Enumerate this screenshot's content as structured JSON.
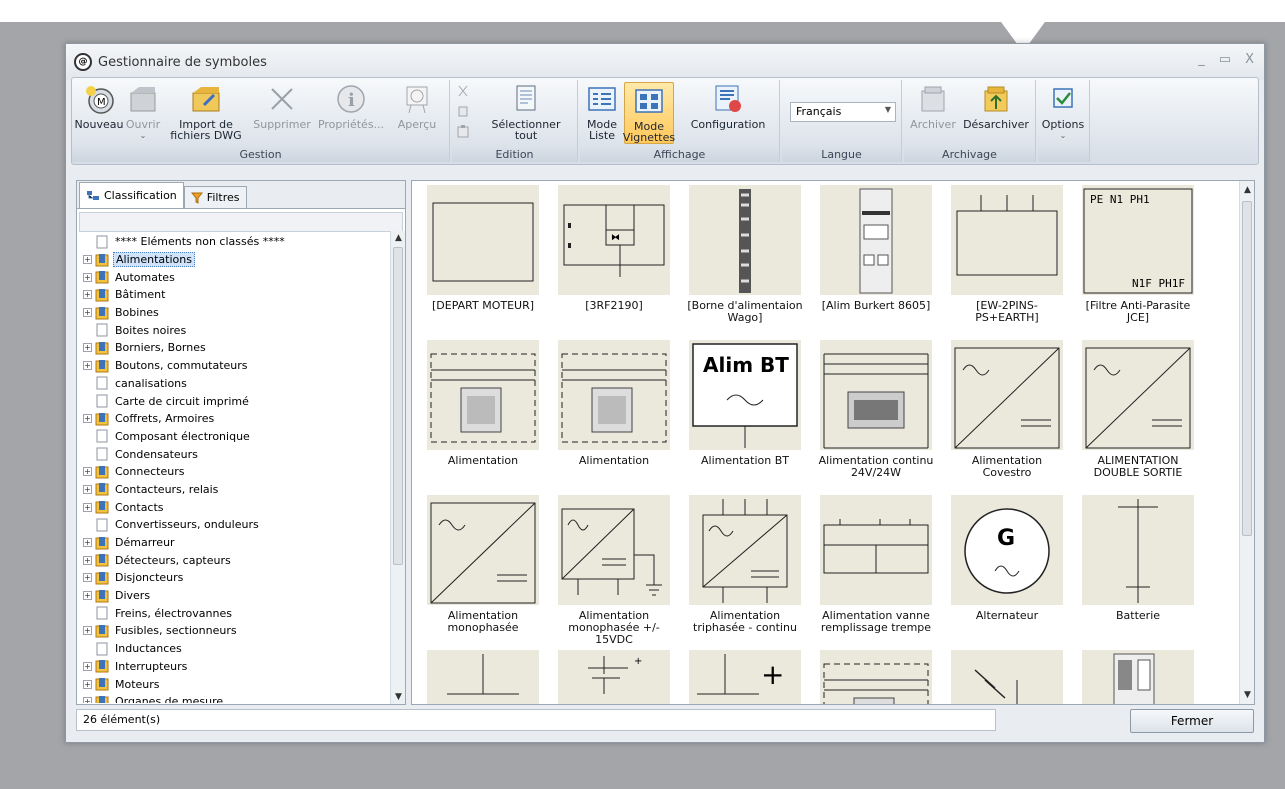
{
  "window": {
    "title": "Gestionnaire de symboles",
    "controls": [
      "_",
      "▭",
      "X"
    ]
  },
  "ribbon": {
    "groups": [
      {
        "label": "Gestion",
        "buttons": [
          {
            "label": "Nouveau",
            "icon": "new-symbol-icon"
          },
          {
            "label": "Ouvrir",
            "icon": "open-icon"
          },
          {
            "label": "Import de fichiers DWG",
            "icon": "import-dwg-icon"
          },
          {
            "label": "Supprimer",
            "icon": "delete-icon"
          },
          {
            "label": "Propriétés...",
            "icon": "info-icon"
          },
          {
            "label": "Aperçu",
            "icon": "preview-icon"
          }
        ]
      },
      {
        "label": "Edition",
        "buttons": [
          {
            "label": "Sélectionner tout",
            "icon": "select-all-icon"
          }
        ]
      },
      {
        "label": "Affichage",
        "buttons": [
          {
            "label": "Mode Liste",
            "icon": "list-mode-icon"
          },
          {
            "label": "Mode Vignettes",
            "icon": "thumbnail-mode-icon"
          },
          {
            "label": "Configuration",
            "icon": "configuration-icon"
          }
        ]
      },
      {
        "label": "Langue",
        "select_value": "Français"
      },
      {
        "label": "Archivage",
        "buttons": [
          {
            "label": "Archiver",
            "icon": "archive-icon"
          },
          {
            "label": "Désarchiver",
            "icon": "unarchive-icon"
          }
        ]
      },
      {
        "label": "",
        "buttons": [
          {
            "label": "Options",
            "icon": "checkbox-icon"
          }
        ]
      }
    ]
  },
  "left": {
    "tabs": [
      "Classification",
      "Filtres"
    ],
    "tree": [
      {
        "label": "**** Eléments non classés ****",
        "expandable": false
      },
      {
        "label": "Alimentations",
        "expandable": true,
        "selected": true
      },
      {
        "label": "Automates",
        "expandable": true
      },
      {
        "label": "Bâtiment",
        "expandable": true
      },
      {
        "label": "Bobines",
        "expandable": true
      },
      {
        "label": "Boites noires",
        "expandable": false
      },
      {
        "label": "Borniers, Bornes",
        "expandable": true
      },
      {
        "label": "Boutons, commutateurs",
        "expandable": true
      },
      {
        "label": "canalisations",
        "expandable": false
      },
      {
        "label": "Carte de circuit imprimé",
        "expandable": false
      },
      {
        "label": "Coffrets, Armoires",
        "expandable": true
      },
      {
        "label": "Composant électronique",
        "expandable": false
      },
      {
        "label": "Condensateurs",
        "expandable": false
      },
      {
        "label": "Connecteurs",
        "expandable": true
      },
      {
        "label": "Contacteurs, relais",
        "expandable": true
      },
      {
        "label": "Contacts",
        "expandable": true
      },
      {
        "label": "Convertisseurs, onduleurs",
        "expandable": false
      },
      {
        "label": "Démarreur",
        "expandable": true
      },
      {
        "label": "Détecteurs, capteurs",
        "expandable": true
      },
      {
        "label": "Disjoncteurs",
        "expandable": true
      },
      {
        "label": "Divers",
        "expandable": true
      },
      {
        "label": "Freins, électrovannes",
        "expandable": false
      },
      {
        "label": "Fusibles, sectionneurs",
        "expandable": true
      },
      {
        "label": "Inductances",
        "expandable": false
      },
      {
        "label": "Interrupteurs",
        "expandable": true
      },
      {
        "label": "Moteurs",
        "expandable": true
      },
      {
        "label": "Organes de mesure",
        "expandable": true
      }
    ]
  },
  "symbols": [
    {
      "caption": "[DEPART MOTEUR]",
      "kind": "rect"
    },
    {
      "caption": "[3RF2190]",
      "kind": "relay"
    },
    {
      "caption": "[Borne d'alimentaion Wago]",
      "kind": "terminal"
    },
    {
      "caption": "[Alim Burkert 8605]",
      "kind": "device"
    },
    {
      "caption": "[EW-2PINS-PS+EARTH]",
      "kind": "pins"
    },
    {
      "caption": "[Filtre Anti-Parasite JCE]",
      "kind": "filter",
      "top_text": "PE   N1  PH1",
      "bottom_text": "N1F PH1F"
    },
    {
      "caption": "Alimentation",
      "kind": "dashed-photo"
    },
    {
      "caption": "Alimentation",
      "kind": "dashed-photo"
    },
    {
      "caption": "Alimentation BT",
      "kind": "albt",
      "text": "Alim BT"
    },
    {
      "caption": "Alimentation continu 24V/24W",
      "kind": "lines-photo"
    },
    {
      "caption": "Alimentation Covestro",
      "kind": "diag"
    },
    {
      "caption": "ALIMENTATION DOUBLE SORTIE",
      "kind": "diag"
    },
    {
      "caption": "Alimentation monophasée",
      "kind": "diag"
    },
    {
      "caption": "Alimentation monophasée +/- 15VDC",
      "kind": "diag-ground"
    },
    {
      "caption": "Alimentation triphasée - continu",
      "kind": "diag-pins"
    },
    {
      "caption": "Alimentation vanne remplissage trempe",
      "kind": "module"
    },
    {
      "caption": "Alternateur",
      "kind": "gen",
      "text": "G"
    },
    {
      "caption": "Batterie",
      "kind": "battery"
    },
    {
      "caption": "",
      "kind": "ground1"
    },
    {
      "caption": "",
      "kind": "plus1"
    },
    {
      "caption": "",
      "kind": "plus2"
    },
    {
      "caption": "",
      "kind": "dashed-photo"
    },
    {
      "caption": "",
      "kind": "arrows"
    },
    {
      "caption": "",
      "kind": "device2"
    }
  ],
  "status": {
    "count": "26 élément(s)"
  },
  "buttons": {
    "close": "Fermer"
  }
}
